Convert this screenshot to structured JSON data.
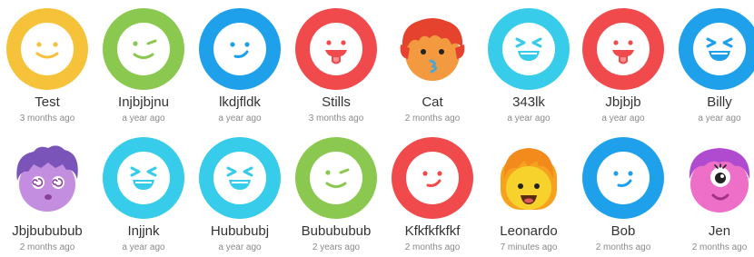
{
  "colors": {
    "yellow": "#f5c23a",
    "green": "#8ac84f",
    "blue": "#1fa0ea",
    "red": "#f04a4c",
    "cyan": "#37ccea",
    "face_white": "#ffffff"
  },
  "profiles": [
    {
      "name": "Test",
      "time": "3 months ago",
      "avatar": "smile-face-icon",
      "color": "#f5c23a"
    },
    {
      "name": "Injbjbjnu",
      "time": "a year ago",
      "avatar": "wink-face-icon",
      "color": "#8ac84f"
    },
    {
      "name": "lkdjfldk",
      "time": "a year ago",
      "avatar": "smirk-face-icon",
      "color": "#1fa0ea"
    },
    {
      "name": "Stills",
      "time": "3 months ago",
      "avatar": "tongue-face-icon",
      "color": "#f04a4c"
    },
    {
      "name": "Cat",
      "time": "2 months ago",
      "avatar": "redhead-boy-avatar-icon",
      "color": "#f39a40"
    },
    {
      "name": "343lk",
      "time": "a year ago",
      "avatar": "grin-face-icon",
      "color": "#37ccea"
    },
    {
      "name": "Jbjbjb",
      "time": "a year ago",
      "avatar": "tongue-face-icon",
      "color": "#f04a4c"
    },
    {
      "name": "Billy",
      "time": "a year ago",
      "avatar": "grin-face-icon",
      "color": "#1fa0ea"
    },
    {
      "name": "Jbjbububub",
      "time": "2 months ago",
      "avatar": "purple-hair-dizzy-avatar-icon",
      "color": "#b07ad8"
    },
    {
      "name": "Injjnk",
      "time": "a year ago",
      "avatar": "grin-face-icon",
      "color": "#37ccea"
    },
    {
      "name": "Hubububj",
      "time": "a year ago",
      "avatar": "grin-face-icon",
      "color": "#37ccea"
    },
    {
      "name": "Bubububub",
      "time": "2 years ago",
      "avatar": "wink-face-icon",
      "color": "#8ac84f"
    },
    {
      "name": "Kfkfkfkfkf",
      "time": "2 months ago",
      "avatar": "smirk-face-icon",
      "color": "#f04a4c"
    },
    {
      "name": "Leonardo",
      "time": "7 minutes ago",
      "avatar": "orange-hair-girl-avatar-icon",
      "color": "#f7d12c"
    },
    {
      "name": "Bob",
      "time": "2 months ago",
      "avatar": "smirk-face-icon",
      "color": "#1fa0ea"
    },
    {
      "name": "Jen",
      "time": "2 months ago",
      "avatar": "pink-cyclops-avatar-icon",
      "color": "#ee6fc8"
    }
  ]
}
